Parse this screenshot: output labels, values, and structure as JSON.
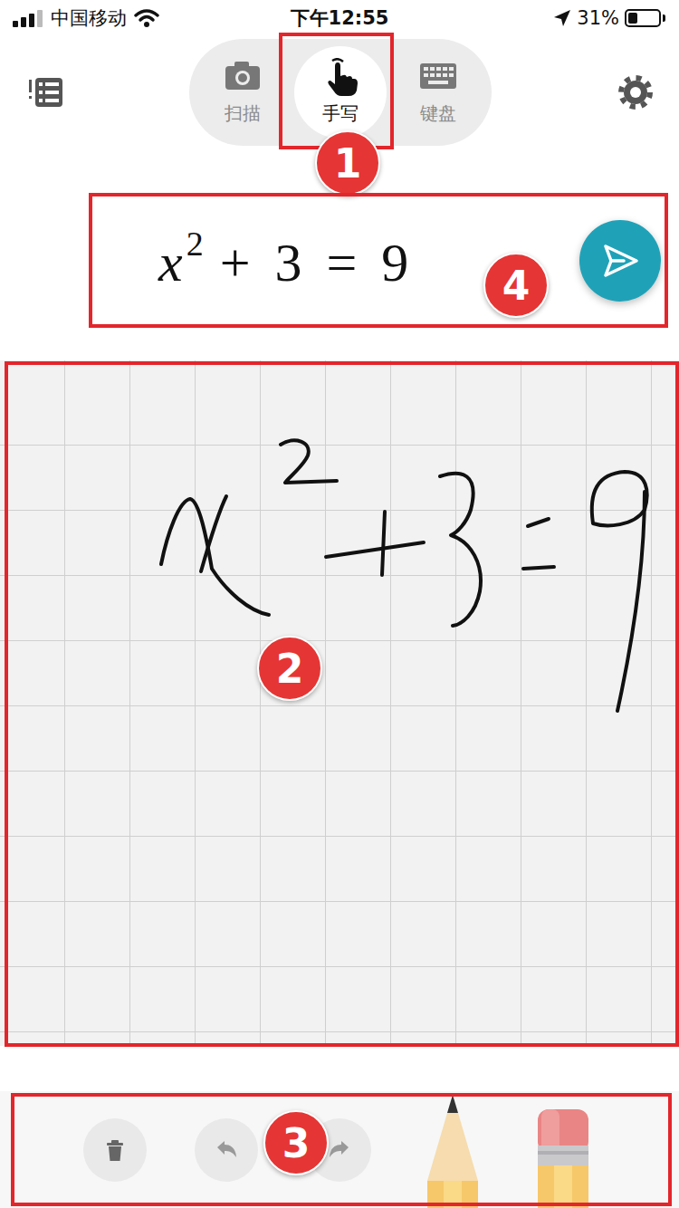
{
  "status_bar": {
    "carrier": "中国移动",
    "time": "下午12:55",
    "battery": "31%",
    "level": 0.31
  },
  "modes": [
    {
      "label": "扫描",
      "kind": "camera",
      "selected": false
    },
    {
      "label": "手写",
      "kind": "hand",
      "selected": true
    },
    {
      "label": "键盘",
      "kind": "keyboard",
      "selected": false
    }
  ],
  "formula": {
    "base": "x",
    "exponent": "2",
    "rest": "+ 3 = 9"
  },
  "actions": [
    {
      "kind": "clear"
    },
    {
      "kind": "undo"
    },
    {
      "kind": "redo"
    }
  ],
  "pens": [
    {
      "kind": "pencil",
      "selected": true
    },
    {
      "kind": "eraser",
      "selected": false
    }
  ],
  "annotations": [
    {
      "number": "1"
    },
    {
      "number": "2"
    },
    {
      "number": "3"
    },
    {
      "number": "4"
    }
  ]
}
